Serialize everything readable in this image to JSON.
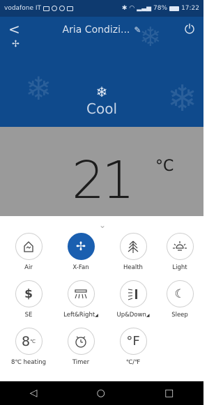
{
  "status_bar": {
    "carrier": "vodafone IT",
    "battery": "78%",
    "time": "17:22"
  },
  "header": {
    "title": "Aria Condizi...",
    "back_icon": "chevron-left-icon",
    "edit_icon": "pencil-icon",
    "power_icon": "power-icon"
  },
  "mode": {
    "label": "Cool",
    "icon": "snowflake-icon"
  },
  "temperature": {
    "value": "21",
    "unit": "°C"
  },
  "controls": [
    {
      "label": "Air",
      "icon": "air-icon",
      "active": false
    },
    {
      "label": "X-Fan",
      "icon": "fan-icon",
      "active": true
    },
    {
      "label": "Health",
      "icon": "health-icon",
      "active": false
    },
    {
      "label": "Light",
      "icon": "light-icon",
      "active": false
    },
    {
      "label": "SE",
      "icon": "dollar-icon",
      "active": false
    },
    {
      "label": "Left&Right",
      "icon": "left-right-swing-icon",
      "active": false
    },
    {
      "label": "Up&Down",
      "icon": "up-down-swing-icon",
      "active": false
    },
    {
      "label": "Sleep",
      "icon": "sleep-icon",
      "active": false
    },
    {
      "label": "8℃ heating",
      "icon": "8c-heating-icon",
      "active": false
    },
    {
      "label": "Timer",
      "icon": "timer-icon",
      "active": false
    },
    {
      "label": "℃/℉",
      "icon": "fahrenheit-icon",
      "active": false
    }
  ],
  "colors": {
    "hero_blue": "#0f4a8c",
    "status_blue": "#0e3a6f",
    "temp_gray": "#9a9a9a",
    "active_blue": "#1a5fb0"
  }
}
